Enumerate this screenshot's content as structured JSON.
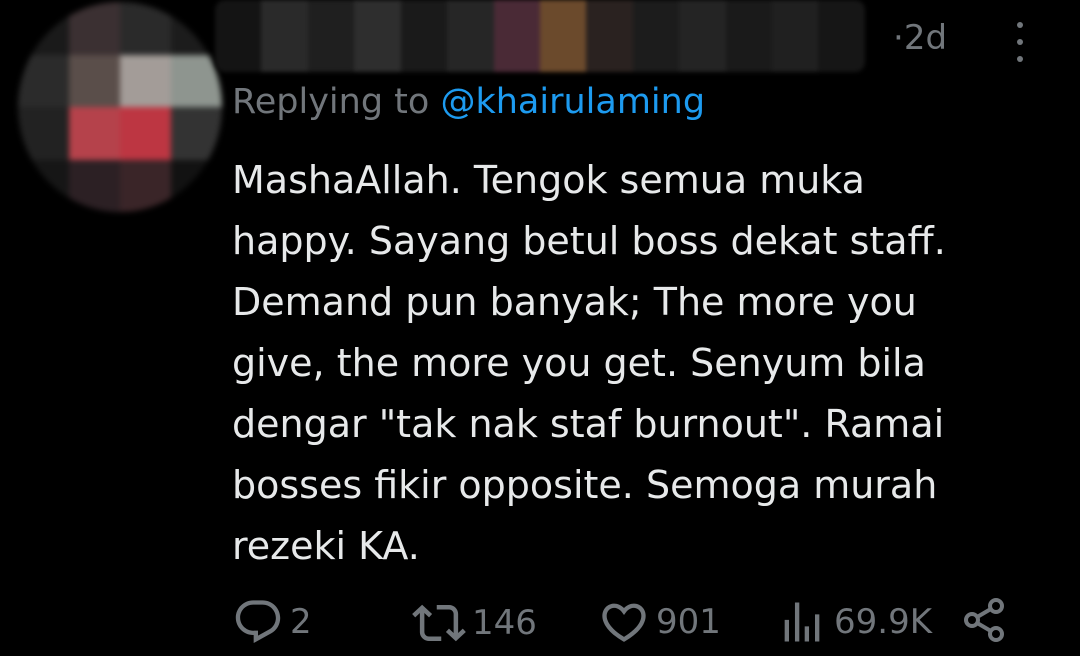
{
  "tweet": {
    "time": "2d",
    "time_separator": "·",
    "replying_prefix": "Replying to ",
    "replying_handle": "@khairulaming",
    "text_lines": [
      "MashaAllah. Tengok semua muka",
      "happy. Sayang betul boss dekat staff.",
      "Demand pun banyak; The more you",
      "give, the more you get. Senyum bila",
      "dengar \"tak nak staf burnout\". Ramai",
      "bosses fikir opposite. Semoga murah",
      "rezeki KA."
    ]
  },
  "actions": {
    "reply": {
      "icon": "reply-icon",
      "count": "2"
    },
    "retweet": {
      "icon": "retweet-icon",
      "count": "146"
    },
    "like": {
      "icon": "heart-icon",
      "count": "901"
    },
    "views": {
      "icon": "views-icon",
      "count": "69.9K"
    },
    "share": {
      "icon": "share-icon"
    }
  },
  "colors": {
    "background": "#000000",
    "text": "#e7e9ea",
    "muted": "#71767b",
    "link": "#1d9bf0"
  }
}
